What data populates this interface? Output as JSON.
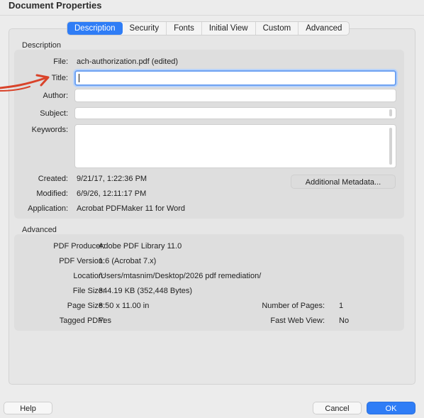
{
  "window": {
    "title": "Document Properties"
  },
  "tabs": [
    {
      "label": "Description",
      "active": true
    },
    {
      "label": "Security",
      "active": false
    },
    {
      "label": "Fonts",
      "active": false
    },
    {
      "label": "Initial View",
      "active": false
    },
    {
      "label": "Custom",
      "active": false
    },
    {
      "label": "Advanced",
      "active": false
    }
  ],
  "description": {
    "section_label": "Description",
    "file_label": "File:",
    "file_value": "ach-authorization.pdf (edited)",
    "title_label": "Title:",
    "title_value": "",
    "author_label": "Author:",
    "author_value": "",
    "subject_label": "Subject:",
    "subject_value": "",
    "keywords_label": "Keywords:",
    "keywords_value": "",
    "created_label": "Created:",
    "created_value": "9/21/17, 1:22:36 PM",
    "modified_label": "Modified:",
    "modified_value": "6/9/26, 12:11:17 PM",
    "application_label": "Application:",
    "application_value": "Acrobat PDFMaker 11 for Word",
    "metadata_button": "Additional Metadata..."
  },
  "advanced": {
    "section_label": "Advanced",
    "producer_label": "PDF Producer:",
    "producer_value": "Adobe PDF Library 11.0",
    "version_label": "PDF Version:",
    "version_value": "1.6 (Acrobat 7.x)",
    "location_label": "Location:",
    "location_value": "/Users/mtasnim/Desktop/2026 pdf remediation/",
    "filesize_label": "File Size:",
    "filesize_value": "344.19 KB (352,448 Bytes)",
    "pagesize_label": "Page Size:",
    "pagesize_value": "8.50 x 11.00 in",
    "pages_label": "Number of Pages:",
    "pages_value": "1",
    "tagged_label": "Tagged PDF:",
    "tagged_value": "Yes",
    "fastweb_label": "Fast Web View:",
    "fastweb_value": "No"
  },
  "footer": {
    "help_label": "Help",
    "cancel_label": "Cancel",
    "ok_label": "OK"
  },
  "colors": {
    "accent": "#2f7df6",
    "annotation_arrow": "#d9432a"
  },
  "icons": {
    "annotation": "red-arrow-icon"
  }
}
